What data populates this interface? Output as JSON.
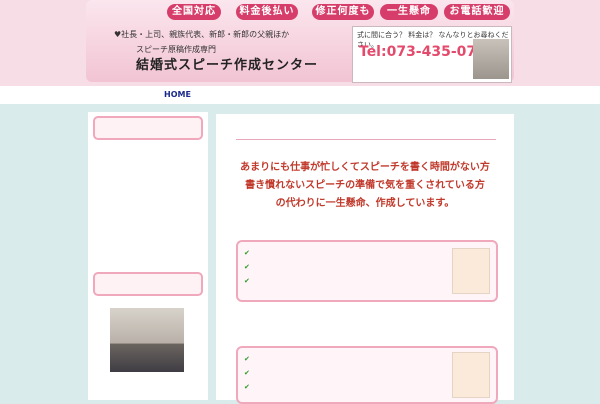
{
  "header": {
    "pills": [
      "全国対応",
      "料金後払い",
      "修正何度も",
      "一生懸命",
      "お電話歓迎"
    ],
    "targets": "♥社長・上司、親族代表、新郎・新郎の父親ほか",
    "subtitle": "スピーチ原稿作成専門",
    "title": "結婚式スピーチ作成センター",
    "phone": {
      "question": "式に間に合う？ 料金は？ なんなりとお尋ねください。",
      "number": "Tel:073-435-0707",
      "hours": "",
      "note": ""
    }
  },
  "nav": {
    "items": [
      "HOME",
      "",
      "",
      "",
      "",
      "",
      ""
    ]
  },
  "sidebar": {
    "section1_title": "",
    "section1_lines": [
      "",
      ""
    ],
    "links": [
      "",
      ""
    ],
    "section1_text2": "",
    "section1_link3": "",
    "section2_title": "",
    "profile_lines": [
      "",
      ""
    ]
  },
  "main": {
    "hero": [
      "あまりにも仕事が忙しくてスピーチを書く時間がない方",
      "書き慣れないスピーチの準備で気を重くされている方",
      "の代わりに一生懸命、作成しています。"
    ],
    "section1_head": "",
    "section1_items": [
      "",
      "",
      ""
    ],
    "section2_head": "",
    "section2_items": [
      "",
      "",
      ""
    ]
  },
  "colors": {
    "accent": "#d63d6a",
    "link": "#1a2a8a",
    "hero_text": "#c0392b",
    "background": "#d9eceb"
  }
}
